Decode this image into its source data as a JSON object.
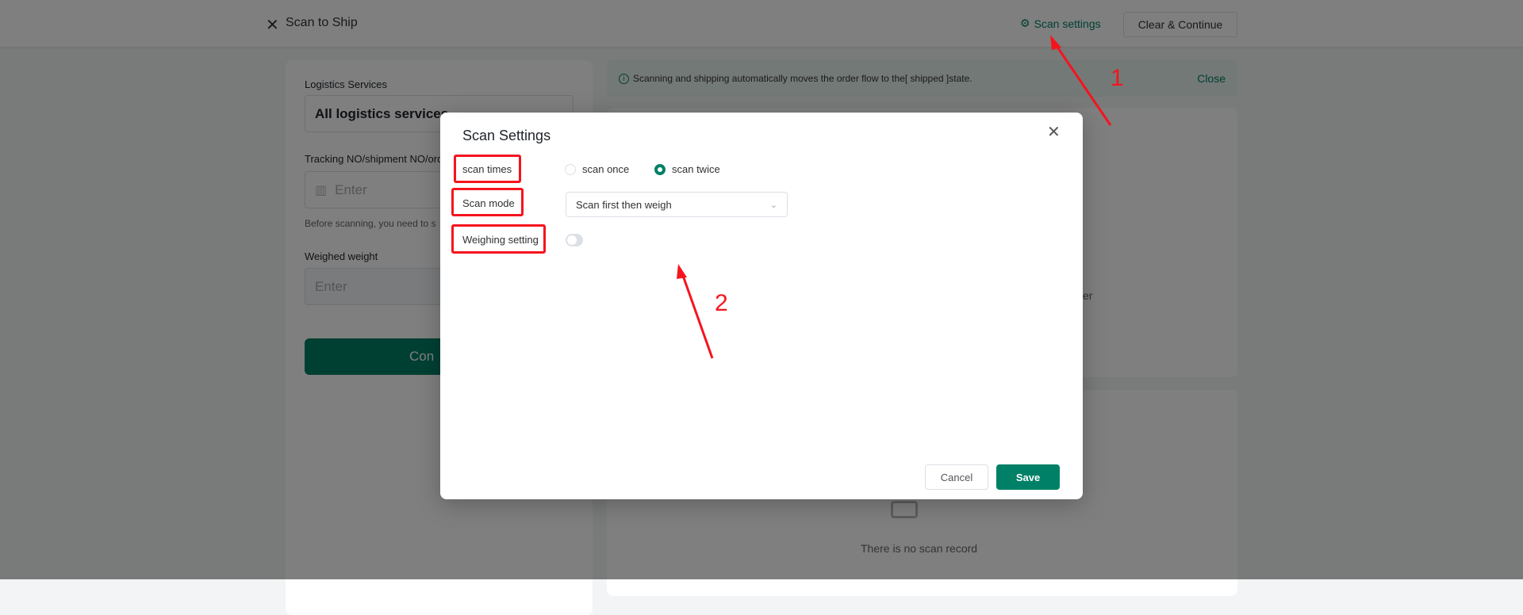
{
  "header": {
    "title": "Scan to Ship",
    "scan_settings": "Scan settings",
    "clear_continue": "Clear & Continue"
  },
  "left": {
    "logistics_label": "Logistics Services",
    "logistics_value": "All logistics services",
    "tracking_label": "Tracking NO/shipment NO/ord",
    "tracking_placeholder": "Enter",
    "help_text": "Before scanning, you need to s",
    "weight_label": "Weighed weight",
    "weight_placeholder": "Enter",
    "confirm": "Con"
  },
  "info": {
    "text": "Scanning and shipping automatically moves the order flow to the[ shipped ]state.",
    "close": "Close"
  },
  "right": {
    "partial_text": "er",
    "empty_text": "There is no scan record"
  },
  "modal": {
    "title": "Scan Settings",
    "scan_times_label": "scan times",
    "scan_once": "scan once",
    "scan_twice": "scan twice",
    "scan_times_selected": "scan twice",
    "scan_mode_label": "Scan mode",
    "scan_mode_value": "Scan first then weigh",
    "weighing_label": "Weighing setting",
    "weighing_enabled": false,
    "cancel": "Cancel",
    "save": "Save"
  },
  "annotations": {
    "one": "1",
    "two": "2"
  },
  "colors": {
    "accent": "#008066",
    "annotation": "#f5141e"
  }
}
